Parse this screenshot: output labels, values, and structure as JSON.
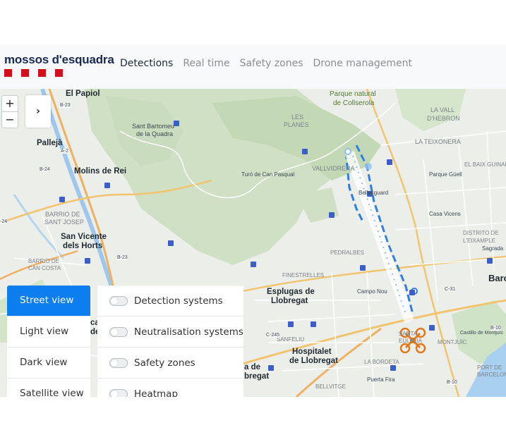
{
  "brand": {
    "name": "mossos d'esquadra",
    "square_color": "#d30f1a",
    "text_color": "#1a2a53"
  },
  "nav": {
    "items": [
      {
        "label": "Detections",
        "active": true
      },
      {
        "label": "Real time",
        "active": false
      },
      {
        "label": "Safety zones",
        "active": false
      },
      {
        "label": "Drone management",
        "active": false
      }
    ]
  },
  "map_controls": {
    "zoom_in": "+",
    "zoom_out": "−",
    "expand_icon": "chevron-right-icon"
  },
  "views": {
    "active_color": "#0d7ef0",
    "items": [
      {
        "label": "Street view",
        "active": true
      },
      {
        "label": "Light view",
        "active": false
      },
      {
        "label": "Dark view",
        "active": false
      },
      {
        "label": "Satellite view",
        "active": false
      }
    ]
  },
  "layers": {
    "items": [
      {
        "label": "Detection systems",
        "on": false
      },
      {
        "label": "Neutralisation systems",
        "on": false
      },
      {
        "label": "Safety zones",
        "on": false
      },
      {
        "label": "Heatmap",
        "on": false
      }
    ]
  },
  "map_labels": {
    "el_papiol": "El Papiol",
    "b23a": "B-23",
    "sant_bartomeu": "Sant Bartomeu",
    "de_la_quadra": "de la Quadra",
    "parque_natural": "Parque natural",
    "de_collserola": "de Collserola",
    "les": "LES",
    "planes": "PLANES",
    "la_vall": "LA VALL",
    "d_hebron": "D'HEBRON",
    "la_teixonera": "LA TEIXONERA",
    "palleja": "Pallejà",
    "molins": "Molins de Rei",
    "turo": "Turó de Can Pasqual",
    "vallvidrera": "VALLVIDRERA",
    "bellesguard": "Bellesguard",
    "parque_guell": "Parque Güell",
    "el_baix_guinardo": "EL BAIX GUINARDÓ",
    "b24": "B-24",
    "a2": "A-2",
    "barrio_de": "BARRIO DE",
    "sant_josep": "SANT JOSEP",
    "sant_vicente": "San Vicente",
    "dels_horts": "dels Horts",
    "casa_vicens": "Casa Vicens",
    "distrito_de": "DISTRITO DE",
    "l_eixample": "L'EIXAMPLE",
    "sagrada": "Sagrada",
    "b23b": "B-23",
    "barrio_de_2": "BARRIO DE",
    "can_costa": "CAN COSTA",
    "pedralbes": "PEDRALBES",
    "finestrelles": "FINESTRELLES",
    "esplugues": "Esplugas de",
    "llobregat": "Llobregat",
    "camp_nou": "Campo Nou",
    "barcelona": "Barc",
    "c31": "C-31",
    "santa": "SANTA",
    "eulalia": "EULÀLIA",
    "montjuic": "MONTJUÏC",
    "castillo": "Castillo de Montjuïc",
    "b10a": "B-10",
    "sanfeliu": "SANFELIU",
    "hospitalet": "Hospitalet",
    "de_llobregat": "de Llobregat",
    "c245": "C-245",
    "la_bordeta": "LA BORDETA",
    "bellvitge": "BELLVITGE",
    "puerta_fira": "Puerta Fira",
    "b10b": "B-10",
    "port": "PORT DE",
    "barcelona_port": "BARCELONA",
    "a_de": "a de",
    "bregat": "bregat",
    "ca": "ca",
    "de": "de",
    "b22": "-24"
  },
  "colors": {
    "flight_path": "#2f7fe0",
    "flight_dots": "#8fc0f5",
    "drone": "#e07a1f",
    "park": "#cfe0c4"
  }
}
